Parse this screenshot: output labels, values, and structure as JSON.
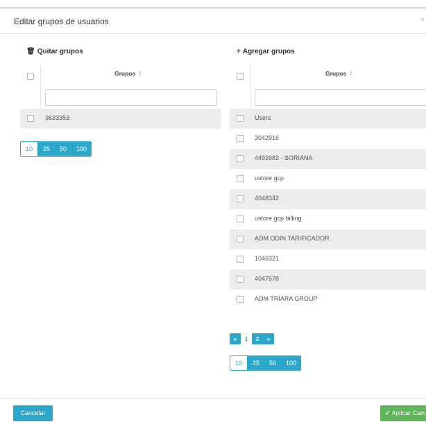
{
  "modal": {
    "title": "Editar grupos de usuarios",
    "close_glyph": "×"
  },
  "left": {
    "title_icon": "🗑",
    "title": "Quitar grupos",
    "column_header": "Grupos",
    "sort_glyph": "⇕",
    "filter_value": "",
    "rows": [
      "3633353"
    ],
    "page_sizes": [
      "10",
      "25",
      "50",
      "100"
    ],
    "active_page_size": "10"
  },
  "right": {
    "title_icon": "+",
    "title": "Agregar grupos",
    "column_header": "Grupos",
    "sort_glyph": "⇕",
    "filter_value": "",
    "rows": [
      "Users",
      "3042916",
      "4492682 - SORIANA",
      "ustore gcp",
      "4048342",
      "ustore gcp billing",
      "ADM ODIN TARIFICADOR",
      "1046321",
      "4047578",
      "ADM TRIARA GROUP"
    ],
    "pagination": {
      "prev": "«",
      "pages": [
        "1",
        "2"
      ],
      "next": "»",
      "current": "1"
    },
    "page_sizes": [
      "10",
      "25",
      "50",
      "100"
    ],
    "active_page_size": "10"
  },
  "footer": {
    "cancel_label": "Cancelar",
    "apply_icon": "✔",
    "apply_label": "Aplicar Cambios"
  },
  "colors": {
    "accent": "#2aa7c9",
    "success": "#5fb55a",
    "row_stripe": "#ececec"
  }
}
